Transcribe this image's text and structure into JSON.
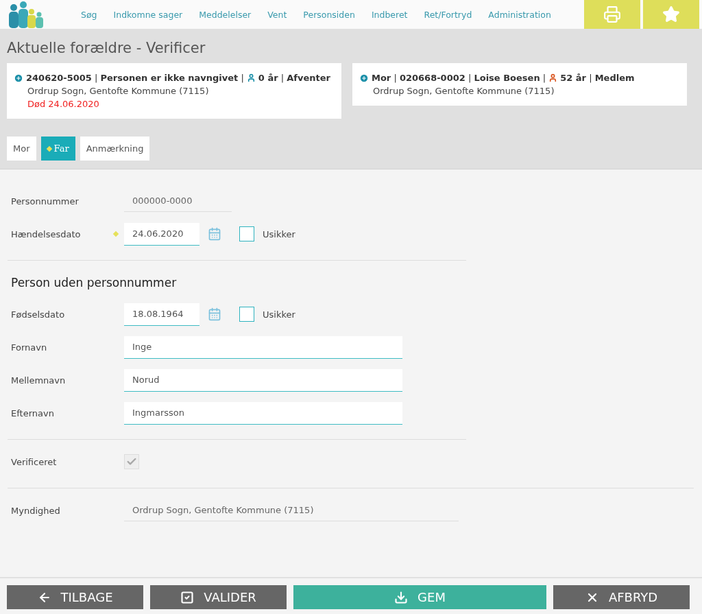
{
  "nav": {
    "links": [
      "Søg",
      "Indkomne sager",
      "Meddelelser",
      "Vent",
      "Personsiden",
      "Indberet",
      "Ret/Fortryd",
      "Administration"
    ],
    "actions": [
      {
        "kind": "print"
      },
      {
        "kind": "favorite"
      }
    ]
  },
  "page_title": "Aktuelle forældre - Verificer",
  "person_cards": [
    {
      "before": "**240620-5005** | **Personen er ikke navngivet** |",
      "color": "#1a8fa8",
      "after": "**0 år** | **Afventer**",
      "lines": [
        {
          "kind": "address",
          "text": "Ordrup Sogn, Gentofte Kommune (7115)"
        },
        {
          "kind": "death",
          "text": "Død 24.06.2020"
        }
      ]
    },
    {
      "before": "**Mor** | **020668-0002** | **Loise Boesen** |",
      "color": "#d9541e",
      "after": "**52 år** | **Medlem**",
      "lines": [
        {
          "kind": "address",
          "text": "Ordrup Sogn, Gentofte Kommune (7115)"
        }
      ]
    }
  ],
  "tabs": [
    {
      "label": "Mor",
      "selected": false,
      "marked": false
    },
    {
      "label": "Far",
      "selected": true,
      "marked": true
    },
    {
      "label": "Anmærkning",
      "selected": false,
      "marked": false
    }
  ],
  "sections": [
    {
      "fields": [
        {
          "kind": "readonly",
          "label": "Personnummer",
          "value": "000000-0000",
          "wide": false
        },
        {
          "kind": "date",
          "label": "Hændelsesdato",
          "value": "24.06.2020",
          "marked": true,
          "uncertain_label": "Usikker",
          "uncertain": false
        }
      ]
    },
    {
      "heading": "Person uden personnummer",
      "fields": [
        {
          "kind": "date",
          "label": "Fødselsdato",
          "value": "18.08.1964",
          "marked": false,
          "uncertain_label": "Usikker",
          "uncertain": false
        },
        {
          "kind": "text",
          "label": "Fornavn",
          "value": "Inge"
        },
        {
          "kind": "text",
          "label": "Mellemnavn",
          "value": "Norud"
        },
        {
          "kind": "text",
          "label": "Efternavn",
          "value": "Ingmarsson"
        }
      ]
    },
    {
      "fields": [
        {
          "kind": "checkbox",
          "label": "Verificeret",
          "checked": true,
          "disabled": true
        }
      ]
    },
    {
      "fields": [
        {
          "kind": "readonly",
          "label": "Myndighed",
          "value": "Ordrup Sogn, Gentofte Kommune (7115)",
          "wide": true
        }
      ]
    }
  ],
  "buttons": [
    {
      "kind": "back",
      "label": "TILBAGE"
    },
    {
      "kind": "validate",
      "label": "VALIDER"
    },
    {
      "kind": "save",
      "label": "GEM"
    },
    {
      "kind": "cancel",
      "label": "AFBRYD"
    }
  ]
}
